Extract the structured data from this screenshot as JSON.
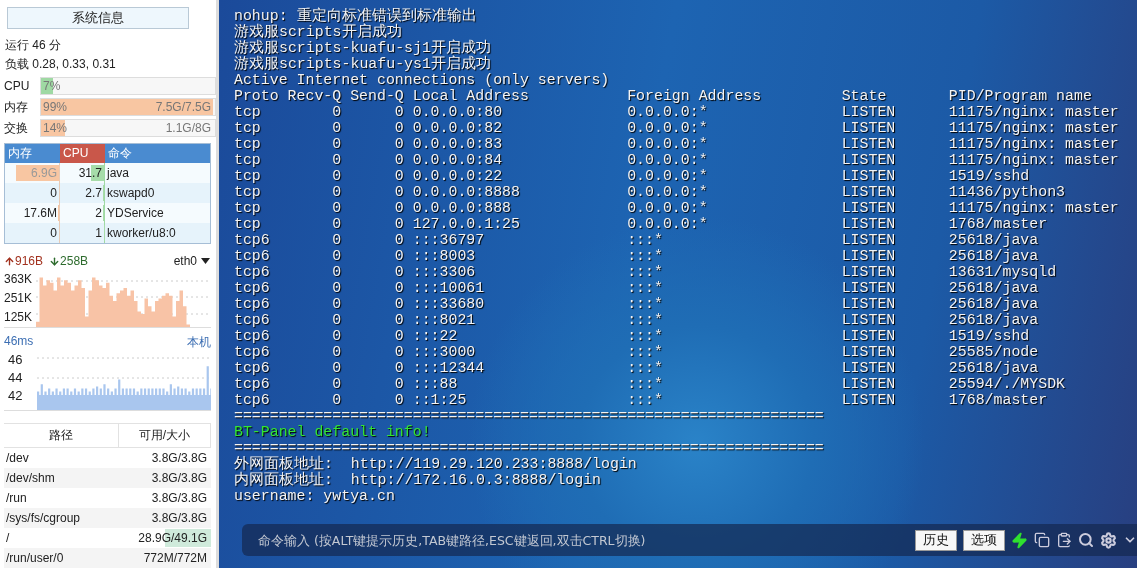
{
  "sidebar": {
    "title_button": "系统信息",
    "uptime": "运行 46 分",
    "load": "负载 0.28, 0.33, 0.31",
    "meters": [
      {
        "label": "CPU",
        "percent": "7%",
        "level": 0.07,
        "color": "#9fd9a3"
      },
      {
        "label": "内存",
        "percent": "99%",
        "detail": "7.5G/7.5G",
        "level": 0.99,
        "color": "#f8c6a2"
      },
      {
        "label": "交换",
        "percent": "14%",
        "detail": "1.1G/8G",
        "level": 0.14,
        "color": "#f8c6a2"
      }
    ],
    "process_table": {
      "columns": [
        {
          "label": "内存",
          "selected": false
        },
        {
          "label": "CPU",
          "selected": true
        },
        {
          "label": "命令",
          "selected": false
        }
      ],
      "rows": [
        {
          "memory": {
            "text": "6.9G",
            "level": 0.8
          },
          "cpu": {
            "text": "31.7",
            "level": 0.3
          },
          "command": "java"
        },
        {
          "memory": {
            "text": "0"
          },
          "cpu": {
            "text": "2.7",
            "level": 0.03
          },
          "command": "kswapd0"
        },
        {
          "memory": {
            "text": "17.6M",
            "level": 0.02
          },
          "cpu": {
            "text": "2",
            "level": 0.02
          },
          "command": "YDService"
        },
        {
          "memory": {
            "text": "0"
          },
          "cpu": {
            "text": "1",
            "level": 0.01
          },
          "command": "kworker/u8:0"
        }
      ]
    },
    "network": {
      "upload": "916B",
      "download": "258B",
      "interface": "eth0",
      "ticks": [
        "363K",
        "251K",
        "125K"
      ]
    },
    "ping": {
      "latency": "46ms",
      "target": "本机",
      "ticks": [
        "46",
        "44",
        "42"
      ]
    },
    "disk_table": {
      "columns": [
        "路径",
        "可用/大小"
      ],
      "rows": [
        {
          "path": "/dev",
          "available_size": "3.8G/3.8G"
        },
        {
          "path": "/dev/shm",
          "available_size": "3.8G/3.8G"
        },
        {
          "path": "/run",
          "available_size": "3.8G/3.8G"
        },
        {
          "path": "/sys/fs/cgroup",
          "available_size": "3.8G/3.8G"
        },
        {
          "path": "/",
          "available_size": "28.9G/49.1G",
          "level": 0.5
        },
        {
          "path": "/run/user/0",
          "available_size": "772M/772M"
        }
      ]
    }
  },
  "terminal": {
    "lines_before": [
      {
        "text": "nohup: 重定向标准错误到标准输出",
        "kind": "normal"
      },
      {
        "text": "游戏服scripts开启成功",
        "kind": "normal"
      },
      {
        "text": "游戏服scripts-kuafu-sj1开启成功",
        "kind": "normal"
      },
      {
        "text": "游戏服scripts-kuafu-ys1开启成功",
        "kind": "normal"
      },
      {
        "text": "Active Internet connections (only servers)",
        "kind": "normal"
      }
    ],
    "netstat": {
      "header": [
        "Proto",
        "Recv-Q",
        "Send-Q",
        "Local Address",
        "Foreign Address",
        "State",
        "PID/Program name"
      ],
      "rows": [
        [
          "tcp",
          "0",
          "0",
          "0.0.0.0:80",
          "0.0.0.0:*",
          "LISTEN",
          "11175/nginx: master"
        ],
        [
          "tcp",
          "0",
          "0",
          "0.0.0.0:82",
          "0.0.0.0:*",
          "LISTEN",
          "11175/nginx: master"
        ],
        [
          "tcp",
          "0",
          "0",
          "0.0.0.0:83",
          "0.0.0.0:*",
          "LISTEN",
          "11175/nginx: master"
        ],
        [
          "tcp",
          "0",
          "0",
          "0.0.0.0:84",
          "0.0.0.0:*",
          "LISTEN",
          "11175/nginx: master"
        ],
        [
          "tcp",
          "0",
          "0",
          "0.0.0.0:22",
          "0.0.0.0:*",
          "LISTEN",
          "1519/sshd"
        ],
        [
          "tcp",
          "0",
          "0",
          "0.0.0.0:8888",
          "0.0.0.0:*",
          "LISTEN",
          "11436/python3"
        ],
        [
          "tcp",
          "0",
          "0",
          "0.0.0.0:888",
          "0.0.0.0:*",
          "LISTEN",
          "11175/nginx: master"
        ],
        [
          "tcp",
          "0",
          "0",
          "127.0.0.1:25",
          "0.0.0.0:*",
          "LISTEN",
          "1768/master"
        ],
        [
          "tcp6",
          "0",
          "0",
          ":::36797",
          ":::*",
          "LISTEN",
          "25618/java"
        ],
        [
          "tcp6",
          "0",
          "0",
          ":::8003",
          ":::*",
          "LISTEN",
          "25618/java"
        ],
        [
          "tcp6",
          "0",
          "0",
          ":::3306",
          ":::*",
          "LISTEN",
          "13631/mysqld"
        ],
        [
          "tcp6",
          "0",
          "0",
          ":::10061",
          ":::*",
          "LISTEN",
          "25618/java"
        ],
        [
          "tcp6",
          "0",
          "0",
          ":::33680",
          ":::*",
          "LISTEN",
          "25618/java"
        ],
        [
          "tcp6",
          "0",
          "0",
          ":::8021",
          ":::*",
          "LISTEN",
          "25618/java"
        ],
        [
          "tcp6",
          "0",
          "0",
          ":::22",
          ":::*",
          "LISTEN",
          "1519/sshd"
        ],
        [
          "tcp6",
          "0",
          "0",
          ":::3000",
          ":::*",
          "LISTEN",
          "25585/node"
        ],
        [
          "tcp6",
          "0",
          "0",
          ":::12344",
          ":::*",
          "LISTEN",
          "25618/java"
        ],
        [
          "tcp6",
          "0",
          "0",
          ":::88",
          ":::*",
          "LISTEN",
          "25594/./MYSDK"
        ],
        [
          "tcp6",
          "0",
          "0",
          "::1:25",
          ":::*",
          "LISTEN",
          "1768/master"
        ]
      ]
    },
    "lines_after": [
      {
        "text": "==================================================================",
        "kind": "normal"
      },
      {
        "text": "BT-Panel default info!",
        "kind": "highlight"
      },
      {
        "text": "==================================================================",
        "kind": "normal"
      },
      {
        "text": "外网面板地址:  http://119.29.120.233:8888/login",
        "kind": "normal"
      },
      {
        "text": "内网面板地址:  http://172.16.0.3:8888/login",
        "kind": "normal"
      },
      {
        "text": "username: ywtya.cn",
        "kind": "normal"
      }
    ]
  },
  "command_bar": {
    "placeholder": "命令输入 (按ALT键提示历史,TAB键路径,ESC键返回,双击CTRL切换)",
    "buttons": [
      "历史",
      "选项"
    ]
  }
}
